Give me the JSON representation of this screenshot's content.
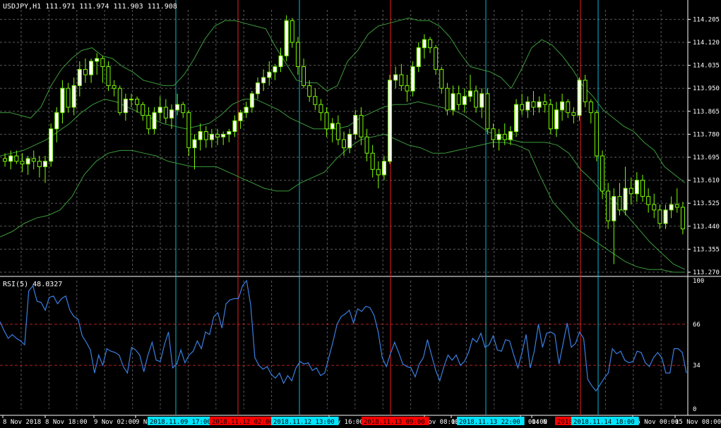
{
  "colors": {
    "background": "#000000",
    "grid": "#5a5a5a",
    "bull_candle": "#7cfc00",
    "bull_body": "#ffffff",
    "bear_candle": "#7cfc00",
    "bear_body": "#000000",
    "bands": "#3c9b3c",
    "rsi_line": "#3a7fe0",
    "rsi_level": "#b22222",
    "vline_cyan": "#00bcd4",
    "vline_red": "#e81e1e",
    "text": "#ffffff",
    "label_cyan_bg": "#00e5ff",
    "label_red_bg": "#ff0000"
  },
  "main_header": "USDJPY,H1  111.971 111.974 111.903 111.908",
  "rsi_header": "RSI(5) 48.0327",
  "chart_data": [
    {
      "type": "candlestick",
      "symbol": "USDJPY,H1",
      "ylim": [
        113.27,
        114.24
      ],
      "yticks": [
        "114.205",
        "114.120",
        "114.035",
        "113.950",
        "113.865",
        "113.780",
        "113.695",
        "113.610",
        "113.525",
        "113.440",
        "113.355",
        "113.270"
      ],
      "ohlc": [
        [
          113.69,
          113.71,
          113.66,
          113.68
        ],
        [
          113.68,
          113.72,
          113.65,
          113.7
        ],
        [
          113.7,
          113.72,
          113.67,
          113.68
        ],
        [
          113.68,
          113.71,
          113.64,
          113.67
        ],
        [
          113.67,
          113.7,
          113.63,
          113.69
        ],
        [
          113.69,
          113.72,
          113.65,
          113.68
        ],
        [
          113.68,
          113.7,
          113.62,
          113.66
        ],
        [
          113.66,
          113.7,
          113.6,
          113.68
        ],
        [
          113.68,
          113.82,
          113.66,
          113.8
        ],
        [
          113.8,
          113.88,
          113.75,
          113.86
        ],
        [
          113.86,
          113.98,
          113.82,
          113.95
        ],
        [
          113.95,
          113.97,
          113.86,
          113.88
        ],
        [
          113.88,
          113.99,
          113.85,
          113.96
        ],
        [
          113.96,
          114.05,
          113.92,
          114.02
        ],
        [
          114.02,
          114.06,
          113.97,
          114.0
        ],
        [
          114.0,
          114.06,
          113.97,
          114.05
        ],
        [
          114.05,
          114.08,
          114.0,
          114.06
        ],
        [
          114.06,
          114.07,
          113.97,
          114.03
        ],
        [
          114.03,
          114.05,
          113.94,
          113.96
        ],
        [
          113.96,
          113.98,
          113.92,
          113.95
        ],
        [
          113.95,
          113.96,
          113.85,
          113.86
        ],
        [
          113.86,
          113.93,
          113.83,
          113.91
        ],
        [
          113.91,
          113.93,
          113.88,
          113.91
        ],
        [
          113.91,
          113.92,
          113.86,
          113.89
        ],
        [
          113.89,
          113.9,
          113.83,
          113.85
        ],
        [
          113.85,
          113.88,
          113.78,
          113.8
        ],
        [
          113.8,
          113.88,
          113.78,
          113.86
        ],
        [
          113.86,
          113.92,
          113.83,
          113.88
        ],
        [
          113.88,
          113.91,
          113.82,
          113.84
        ],
        [
          113.84,
          113.89,
          113.8,
          113.87
        ],
        [
          113.87,
          113.93,
          113.85,
          113.89
        ],
        [
          113.89,
          113.9,
          113.84,
          113.86
        ],
        [
          113.86,
          113.87,
          113.7,
          113.73
        ],
        [
          113.73,
          113.78,
          113.65,
          113.76
        ],
        [
          113.76,
          113.82,
          113.72,
          113.79
        ],
        [
          113.79,
          113.81,
          113.73,
          113.76
        ],
        [
          113.76,
          113.8,
          113.73,
          113.78
        ],
        [
          113.78,
          113.8,
          113.74,
          113.77
        ],
        [
          113.77,
          113.79,
          113.74,
          113.78
        ],
        [
          113.78,
          113.8,
          113.75,
          113.79
        ],
        [
          113.79,
          113.85,
          113.77,
          113.83
        ],
        [
          113.83,
          113.87,
          113.8,
          113.86
        ],
        [
          113.86,
          113.9,
          113.84,
          113.88
        ],
        [
          113.88,
          113.94,
          113.86,
          113.93
        ],
        [
          113.93,
          113.99,
          113.91,
          113.97
        ],
        [
          113.97,
          114.02,
          113.94,
          113.99
        ],
        [
          113.99,
          114.05,
          113.96,
          114.01
        ],
        [
          114.01,
          114.04,
          113.98,
          114.03
        ],
        [
          114.03,
          114.1,
          114.01,
          114.07
        ],
        [
          114.07,
          114.22,
          114.05,
          114.2
        ],
        [
          114.2,
          114.21,
          114.1,
          114.12
        ],
        [
          114.12,
          114.14,
          114.0,
          114.03
        ],
        [
          114.03,
          114.06,
          113.95,
          113.96
        ],
        [
          113.96,
          113.98,
          113.9,
          113.92
        ],
        [
          113.92,
          113.95,
          113.87,
          113.89
        ],
        [
          113.89,
          113.91,
          113.83,
          113.86
        ],
        [
          113.86,
          113.88,
          113.77,
          113.8
        ],
        [
          113.8,
          113.84,
          113.75,
          113.82
        ],
        [
          113.82,
          113.85,
          113.74,
          113.76
        ],
        [
          113.76,
          113.79,
          113.7,
          113.73
        ],
        [
          113.73,
          113.8,
          113.71,
          113.78
        ],
        [
          113.78,
          113.87,
          113.76,
          113.85
        ],
        [
          113.85,
          113.88,
          113.74,
          113.77
        ],
        [
          113.77,
          113.8,
          113.68,
          113.71
        ],
        [
          113.71,
          113.74,
          113.62,
          113.65
        ],
        [
          113.65,
          113.68,
          113.58,
          113.63
        ],
        [
          113.63,
          113.7,
          113.61,
          113.68
        ],
        [
          113.68,
          114.0,
          113.67,
          113.98
        ],
        [
          113.98,
          114.03,
          113.95,
          114.0
        ],
        [
          114.0,
          114.04,
          113.94,
          113.96
        ],
        [
          113.96,
          114.0,
          113.9,
          113.94
        ],
        [
          113.94,
          114.05,
          113.92,
          114.03
        ],
        [
          114.03,
          114.12,
          114.01,
          114.1
        ],
        [
          114.1,
          114.15,
          114.06,
          114.13
        ],
        [
          114.13,
          114.14,
          114.08,
          114.1
        ],
        [
          114.1,
          114.11,
          114.0,
          114.02
        ],
        [
          114.02,
          114.03,
          113.93,
          113.95
        ],
        [
          113.95,
          113.97,
          113.85,
          113.87
        ],
        [
          113.87,
          113.96,
          113.85,
          113.93
        ],
        [
          113.93,
          113.96,
          113.87,
          113.89
        ],
        [
          113.89,
          113.95,
          113.86,
          113.92
        ],
        [
          113.92,
          114.0,
          113.9,
          113.94
        ],
        [
          113.94,
          113.96,
          113.86,
          113.88
        ],
        [
          113.88,
          113.95,
          113.84,
          113.93
        ],
        [
          113.93,
          113.95,
          113.78,
          113.8
        ],
        [
          113.8,
          113.82,
          113.73,
          113.76
        ],
        [
          113.76,
          113.8,
          113.72,
          113.78
        ],
        [
          113.78,
          113.82,
          113.74,
          113.76
        ],
        [
          113.76,
          113.81,
          113.74,
          113.79
        ],
        [
          113.79,
          113.91,
          113.77,
          113.89
        ],
        [
          113.89,
          113.93,
          113.85,
          113.87
        ],
        [
          113.87,
          113.92,
          113.84,
          113.9
        ],
        [
          113.9,
          113.94,
          113.85,
          113.88
        ],
        [
          113.88,
          113.92,
          113.86,
          113.9
        ],
        [
          113.9,
          113.93,
          113.86,
          113.89
        ],
        [
          113.89,
          113.91,
          113.78,
          113.8
        ],
        [
          113.8,
          113.9,
          113.77,
          113.87
        ],
        [
          113.87,
          113.93,
          113.83,
          113.9
        ],
        [
          113.9,
          113.91,
          113.84,
          113.86
        ],
        [
          113.86,
          113.88,
          113.82,
          113.85
        ],
        [
          113.85,
          113.99,
          113.83,
          113.98
        ],
        [
          113.98,
          114.0,
          113.88,
          113.9
        ],
        [
          113.9,
          113.91,
          113.82,
          113.86
        ],
        [
          113.86,
          113.87,
          113.68,
          113.7
        ],
        [
          113.7,
          113.72,
          113.54,
          113.57
        ],
        [
          113.57,
          113.6,
          113.43,
          113.46
        ],
        [
          113.46,
          113.58,
          113.3,
          113.55
        ],
        [
          113.55,
          113.6,
          113.48,
          113.5
        ],
        [
          113.5,
          113.66,
          113.48,
          113.58
        ],
        [
          113.58,
          113.62,
          113.52,
          113.56
        ],
        [
          113.56,
          113.64,
          113.53,
          113.61
        ],
        [
          113.61,
          113.63,
          113.53,
          113.55
        ],
        [
          113.55,
          113.58,
          113.49,
          113.52
        ],
        [
          113.52,
          113.56,
          113.47,
          113.5
        ],
        [
          113.5,
          113.52,
          113.43,
          113.45
        ],
        [
          113.45,
          113.52,
          113.43,
          113.5
        ],
        [
          113.5,
          113.55,
          113.47,
          113.52
        ],
        [
          113.52,
          113.58,
          113.49,
          113.51
        ],
        [
          113.51,
          113.53,
          113.41,
          113.43
        ]
      ],
      "band_upper": [
        113.86,
        113.86,
        113.85,
        113.84,
        113.88,
        113.96,
        114.02,
        114.06,
        114.09,
        114.1,
        114.07,
        114.06,
        114.03,
        114.01,
        113.98,
        113.97,
        113.96,
        113.96,
        114.0,
        114.06,
        114.13,
        114.18,
        114.2,
        114.2,
        114.19,
        114.18,
        114.17,
        114.1,
        114.04,
        113.98,
        113.97,
        113.97,
        113.94,
        113.96,
        114.05,
        114.09,
        114.15,
        114.18,
        114.19,
        114.2,
        114.21,
        114.2,
        114.2,
        114.18,
        114.14,
        114.08,
        114.03,
        114.02,
        114.01,
        113.99,
        113.95,
        114.02,
        114.1,
        114.13,
        114.11,
        114.07,
        114.02,
        113.96,
        113.92,
        113.87,
        113.84,
        113.81,
        113.79,
        113.75,
        113.72,
        113.66,
        113.63,
        113.6
      ],
      "band_mid": [
        113.7,
        113.71,
        113.72,
        113.74,
        113.76,
        113.79,
        113.82,
        113.86,
        113.89,
        113.91,
        113.9,
        113.88,
        113.86,
        113.84,
        113.82,
        113.81,
        113.8,
        113.81,
        113.82,
        113.85,
        113.89,
        113.91,
        113.91,
        113.89,
        113.87,
        113.84,
        113.82,
        113.8,
        113.8,
        113.8,
        113.81,
        113.84,
        113.86,
        113.88,
        113.89,
        113.89,
        113.9,
        113.89,
        113.88,
        113.87,
        113.85,
        113.82,
        113.79,
        113.77,
        113.76,
        113.75,
        113.75,
        113.75,
        113.74,
        113.71,
        113.65,
        113.61,
        113.56,
        113.53,
        113.48,
        113.43,
        113.38,
        113.34,
        113.3,
        113.28
      ],
      "band_lower": [
        113.4,
        113.42,
        113.45,
        113.47,
        113.48,
        113.5,
        113.55,
        113.63,
        113.68,
        113.71,
        113.72,
        113.72,
        113.71,
        113.7,
        113.68,
        113.67,
        113.66,
        113.66,
        113.66,
        113.64,
        113.62,
        113.6,
        113.58,
        113.57,
        113.57,
        113.6,
        113.62,
        113.64,
        113.69,
        113.73,
        113.76,
        113.77,
        113.78,
        113.76,
        113.74,
        113.73,
        113.71,
        113.71,
        113.72,
        113.73,
        113.74,
        113.75,
        113.75,
        113.74,
        113.72,
        113.62,
        113.53,
        113.48,
        113.43,
        113.4,
        113.37,
        113.34,
        113.31,
        113.29,
        113.28,
        113.28,
        113.27,
        113.27
      ]
    },
    {
      "type": "line",
      "name": "RSI(5) 48.0327",
      "ylim": [
        0,
        100
      ],
      "yticks": [
        "100",
        "66",
        "34",
        "0"
      ],
      "levels": [
        66,
        34
      ],
      "values": [
        68,
        61,
        55,
        58,
        55,
        53,
        50,
        92,
        96,
        84,
        83,
        77,
        87,
        88,
        82,
        86,
        88,
        77,
        72,
        70,
        57,
        52,
        46,
        28,
        42,
        34,
        47,
        45,
        44,
        42,
        33,
        28,
        48,
        46,
        42,
        29,
        42,
        52,
        38,
        37,
        50,
        60,
        32,
        35,
        46,
        36,
        42,
        45,
        53,
        47,
        60,
        58,
        72,
        75,
        63,
        82,
        85,
        86,
        86,
        96,
        100,
        81,
        40,
        34,
        31,
        33,
        27,
        24,
        28,
        20,
        26,
        22,
        32,
        37,
        35,
        36,
        30,
        32,
        26,
        28,
        40,
        52,
        66,
        72,
        74,
        77,
        67,
        78,
        76,
        80,
        79,
        73,
        60,
        40,
        33,
        43,
        52,
        44,
        35,
        33,
        32,
        25,
        35,
        40,
        54,
        42,
        30,
        22,
        33,
        42,
        38,
        42,
        34,
        37,
        44,
        55,
        52,
        59,
        48,
        50,
        57,
        46,
        45,
        54,
        53,
        42,
        32,
        44,
        58,
        32,
        45,
        66,
        48,
        59,
        60,
        58,
        35,
        51,
        67,
        48,
        51,
        60,
        55,
        23,
        18,
        14,
        19,
        24,
        28,
        47,
        43,
        45,
        38,
        36,
        37,
        45,
        44,
        36,
        33,
        40,
        44,
        40,
        28,
        28,
        47,
        47,
        44,
        28
      ]
    }
  ],
  "x_axis_labels": [
    "8 Nov 2018",
    "8 Nov 18:00",
    "9 Nov 02:00",
    "9 No",
    "Nov 16:00",
    "Nov 08:00",
    "13",
    "v 00:00",
    "14 N",
    "15 Nov 00:00",
    "15 Nov 08:00"
  ],
  "vline_labels": [
    {
      "text": "2018.11.09 17:00",
      "kind": "cyan"
    },
    {
      "text": "2018.11.12 02:00",
      "kind": "red"
    },
    {
      "text": "2018.11.12 13:00",
      "kind": "cyan"
    },
    {
      "text": "2018.11.13 09:00",
      "kind": "red"
    },
    {
      "text": "2018.11.13 22:00",
      "kind": "cyan"
    },
    {
      "text": "2018",
      "kind": "red"
    },
    {
      "text": "2018.11.14 18:00",
      "kind": "cyan"
    }
  ]
}
